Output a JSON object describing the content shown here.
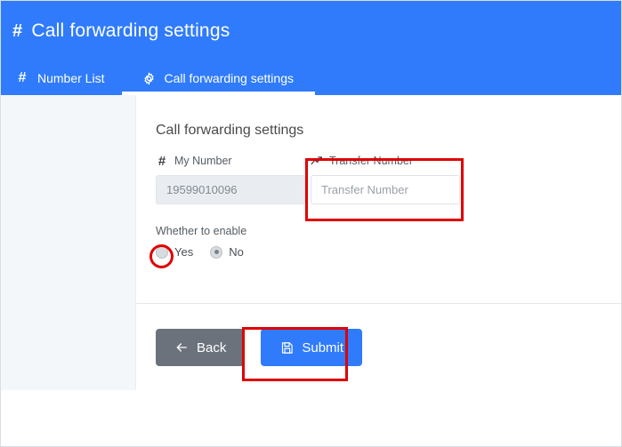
{
  "header": {
    "title": "Call forwarding settings",
    "icon": "hash-icon",
    "accent_color": "#2f7bfc"
  },
  "tabs": [
    {
      "label": "Number List",
      "icon": "hash-icon",
      "active": false
    },
    {
      "label": "Call forwarding settings",
      "icon": "gear-icon",
      "active": true
    }
  ],
  "form": {
    "title": "Call forwarding settings",
    "fields": [
      {
        "label": "My Number",
        "icon": "hash-icon",
        "value": "19599010096",
        "placeholder": "",
        "disabled": true
      },
      {
        "label": "Transfer Number",
        "icon": "trending-up-icon",
        "value": "",
        "placeholder": "Transfer Number",
        "disabled": false
      }
    ],
    "enable": {
      "label": "Whether to enable",
      "options": [
        {
          "label": "Yes",
          "checked": false
        },
        {
          "label": "No",
          "checked": true
        }
      ]
    }
  },
  "actions": {
    "back_label": "Back",
    "back_icon": "arrow-left-icon",
    "back_color": "#6b727c",
    "submit_label": "Submit",
    "submit_icon": "save-icon",
    "submit_color": "#2f7bfc"
  },
  "annotations": {
    "color": "#e00000",
    "items": [
      "transfer-number-field-highlight",
      "yes-radio-highlight",
      "submit-button-highlight"
    ]
  }
}
